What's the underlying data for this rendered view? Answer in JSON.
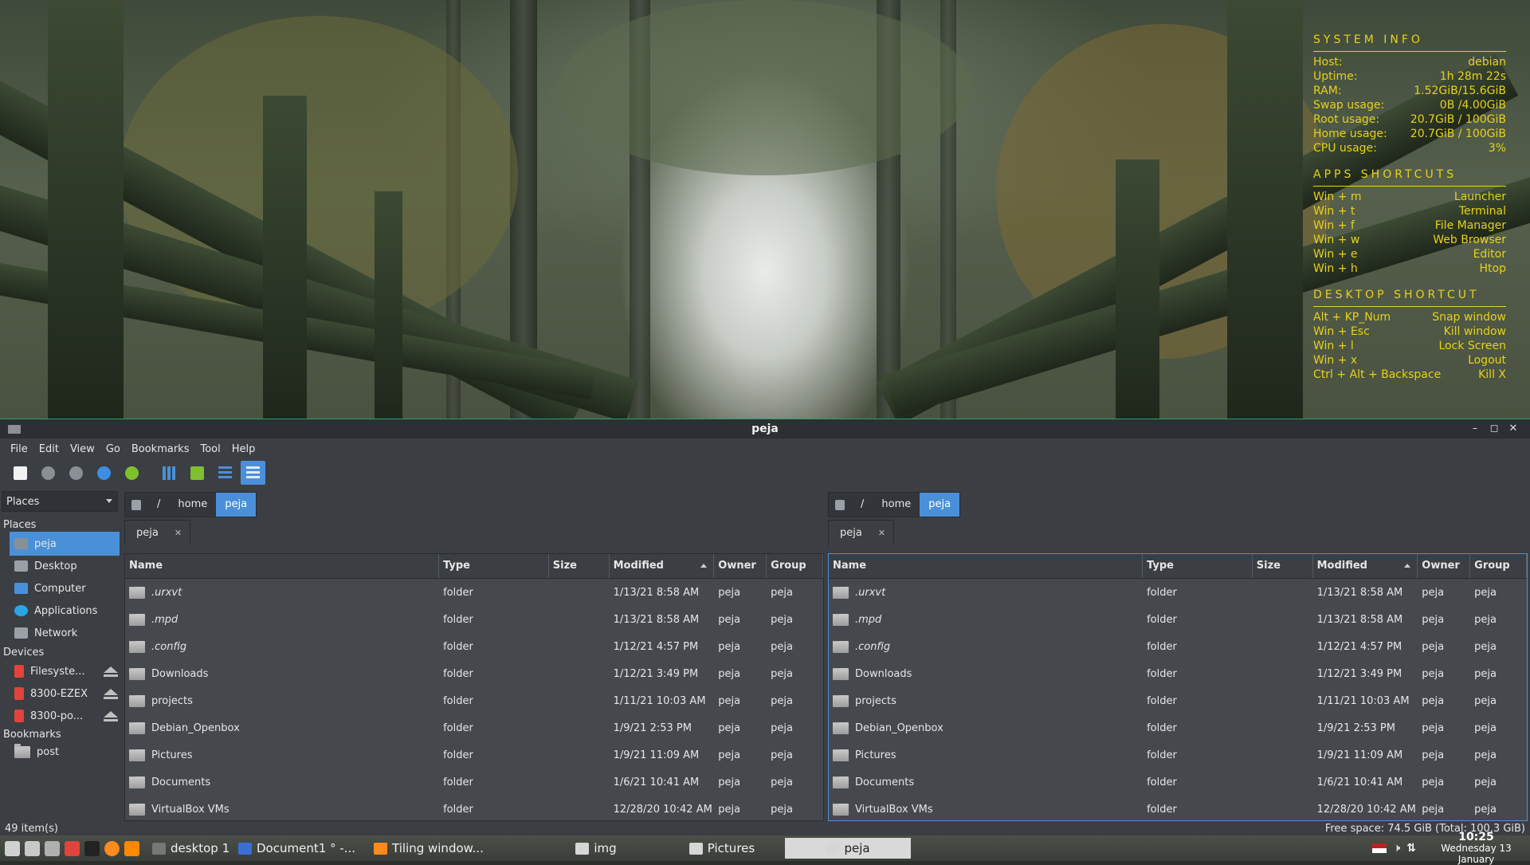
{
  "conky": {
    "sections": [
      {
        "title": "SYSTEM  INFO",
        "rows": [
          {
            "label": "Host:",
            "value": "debian"
          },
          {
            "label": "Uptime:",
            "value": "1h 28m 22s"
          },
          {
            "label": "RAM:",
            "value": "1.52GiB/15.6GiB"
          },
          {
            "label": "Swap usage:",
            "value": "0B  /4.00GiB"
          },
          {
            "label": "Root usage:",
            "value": "20.7GiB / 100GiB"
          },
          {
            "label": "Home usage:",
            "value": "20.7GiB / 100GiB"
          },
          {
            "label": "CPU usage:",
            "value": "3%"
          }
        ]
      },
      {
        "title": "APPS  SHORTCUTS",
        "rows": [
          {
            "label": "Win + m",
            "value": "Launcher"
          },
          {
            "label": "Win + t",
            "value": "Terminal"
          },
          {
            "label": "Win + f",
            "value": "File Manager"
          },
          {
            "label": "Win + w",
            "value": "Web Browser"
          },
          {
            "label": "Win + e",
            "value": "Editor"
          },
          {
            "label": "Win + h",
            "value": "Htop"
          }
        ]
      },
      {
        "title": "DESKTOP  SHORTCUT",
        "rows": [
          {
            "label": "Alt + KP_Num",
            "value": "Snap window"
          },
          {
            "label": "Win + Esc",
            "value": "Kill window"
          },
          {
            "label": "Win + l",
            "value": "Lock Screen"
          },
          {
            "label": "Win + x",
            "value": "Logout"
          },
          {
            "label": "Ctrl + Alt + Backspace",
            "value": "Kill X"
          }
        ]
      }
    ]
  },
  "window": {
    "title": "peja",
    "menu": [
      "File",
      "Edit",
      "View",
      "Go",
      "Bookmarks",
      "Tool",
      "Help"
    ],
    "toolbar": [
      {
        "icon": "new-window-icon",
        "color": "#f2f2f2"
      },
      {
        "icon": "back-icon",
        "color": "#8a8f96"
      },
      {
        "icon": "forward-icon",
        "color": "#8a8f96"
      },
      {
        "icon": "up-icon",
        "color": "#3d8ee0"
      },
      {
        "icon": "reload-icon",
        "color": "#7ec12e"
      },
      {
        "icon": "icon-view-icon",
        "color": "#4a90d9"
      },
      {
        "icon": "thumbnail-view-icon",
        "color": "#7ec12e"
      },
      {
        "icon": "compact-view-icon",
        "color": "#4a90d9"
      },
      {
        "icon": "detailed-list-view-icon",
        "color": "#4a90d9"
      }
    ]
  },
  "sidepane": {
    "selector": "Places",
    "places_heading": "Places",
    "places": [
      {
        "label": "peja",
        "icon": "home-folder-icon",
        "selected": true
      },
      {
        "label": "Desktop",
        "icon": "desktop-icon",
        "selected": false
      },
      {
        "label": "Computer",
        "icon": "computer-icon",
        "selected": false
      },
      {
        "label": "Applications",
        "icon": "applications-icon",
        "selected": false
      },
      {
        "label": "Network",
        "icon": "network-icon",
        "selected": false
      }
    ],
    "devices_heading": "Devices",
    "devices": [
      {
        "label": "Filesyste..."
      },
      {
        "label": "8300-EZEX"
      },
      {
        "label": "8300-po..."
      }
    ],
    "bookmarks_heading": "Bookmarks",
    "bookmarks": [
      {
        "label": "post"
      }
    ]
  },
  "columns": [
    "Name",
    "Type",
    "Size",
    "Modified",
    "Owner",
    "Group"
  ],
  "panes": [
    {
      "path": [
        "/",
        "home",
        "peja"
      ],
      "tab": "peja",
      "files": [
        {
          "name": ".urxvt",
          "hidden": true,
          "type": "folder",
          "size": "",
          "modified": "1/13/21 8:58 AM",
          "owner": "peja",
          "group": "peja"
        },
        {
          "name": ".mpd",
          "hidden": true,
          "type": "folder",
          "size": "",
          "modified": "1/13/21 8:58 AM",
          "owner": "peja",
          "group": "peja"
        },
        {
          "name": ".config",
          "hidden": true,
          "type": "folder",
          "size": "",
          "modified": "1/12/21 4:57 PM",
          "owner": "peja",
          "group": "peja"
        },
        {
          "name": "Downloads",
          "hidden": false,
          "type": "folder",
          "size": "",
          "modified": "1/12/21 3:49 PM",
          "owner": "peja",
          "group": "peja"
        },
        {
          "name": "projects",
          "hidden": false,
          "type": "folder",
          "size": "",
          "modified": "1/11/21 10:03 AM",
          "owner": "peja",
          "group": "peja"
        },
        {
          "name": "Debian_Openbox",
          "hidden": false,
          "type": "folder",
          "size": "",
          "modified": "1/9/21 2:53 PM",
          "owner": "peja",
          "group": "peja"
        },
        {
          "name": "Pictures",
          "hidden": false,
          "type": "folder",
          "size": "",
          "modified": "1/9/21 11:09 AM",
          "owner": "peja",
          "group": "peja"
        },
        {
          "name": "Documents",
          "hidden": false,
          "type": "folder",
          "size": "",
          "modified": "1/6/21 10:41 AM",
          "owner": "peja",
          "group": "peja"
        },
        {
          "name": "VirtualBox VMs",
          "hidden": false,
          "type": "folder",
          "size": "",
          "modified": "12/28/20 10:42 AM",
          "owner": "peja",
          "group": "peja"
        }
      ]
    },
    {
      "path": [
        "/",
        "home",
        "peja"
      ],
      "tab": "peja",
      "files": [
        {
          "name": ".urxvt",
          "hidden": true,
          "type": "folder",
          "size": "",
          "modified": "1/13/21 8:58 AM",
          "owner": "peja",
          "group": "peja"
        },
        {
          "name": ".mpd",
          "hidden": true,
          "type": "folder",
          "size": "",
          "modified": "1/13/21 8:58 AM",
          "owner": "peja",
          "group": "peja"
        },
        {
          "name": ".config",
          "hidden": true,
          "type": "folder",
          "size": "",
          "modified": "1/12/21 4:57 PM",
          "owner": "peja",
          "group": "peja"
        },
        {
          "name": "Downloads",
          "hidden": false,
          "type": "folder",
          "size": "",
          "modified": "1/12/21 3:49 PM",
          "owner": "peja",
          "group": "peja"
        },
        {
          "name": "projects",
          "hidden": false,
          "type": "folder",
          "size": "",
          "modified": "1/11/21 10:03 AM",
          "owner": "peja",
          "group": "peja"
        },
        {
          "name": "Debian_Openbox",
          "hidden": false,
          "type": "folder",
          "size": "",
          "modified": "1/9/21 2:53 PM",
          "owner": "peja",
          "group": "peja"
        },
        {
          "name": "Pictures",
          "hidden": false,
          "type": "folder",
          "size": "",
          "modified": "1/9/21 11:09 AM",
          "owner": "peja",
          "group": "peja"
        },
        {
          "name": "Documents",
          "hidden": false,
          "type": "folder",
          "size": "",
          "modified": "1/6/21 10:41 AM",
          "owner": "peja",
          "group": "peja"
        },
        {
          "name": "VirtualBox VMs",
          "hidden": false,
          "type": "folder",
          "size": "",
          "modified": "12/28/20 10:42 AM",
          "owner": "peja",
          "group": "peja"
        }
      ]
    }
  ],
  "status": {
    "items": "49 item(s)",
    "free_space": "Free space: 74.5 GiB (Total: 100.3 GiB)"
  },
  "taskbar": {
    "launchers": [
      {
        "icon": "show-desktop-icon",
        "color": "#d0d0d0"
      },
      {
        "icon": "file-manager-icon",
        "color": "#c8c8c8"
      },
      {
        "icon": "settings-icon",
        "color": "#b0b0b0"
      },
      {
        "icon": "app-x-icon",
        "color": "#e0443a"
      },
      {
        "icon": "terminal-icon",
        "color": "#222222"
      },
      {
        "icon": "firefox-icon",
        "color": "#ff8a1f"
      },
      {
        "icon": "vlc-icon",
        "color": "#ff8800"
      }
    ],
    "tasks": [
      {
        "label": "desktop 1",
        "icon": "workspace-icon",
        "active": false
      },
      {
        "label": "Document1 ° -...",
        "icon": "writer-icon",
        "active": false
      },
      {
        "label": "Tiling window...",
        "icon": "firefox-icon",
        "active": false
      },
      {
        "label": "img",
        "icon": "folder-icon",
        "active": false
      },
      {
        "label": "Pictures",
        "icon": "folder-icon",
        "active": false
      },
      {
        "label": "peja",
        "icon": "folder-icon",
        "active": true
      }
    ],
    "clock_time": "10:25",
    "clock_date": "Wednesday 13 January"
  }
}
